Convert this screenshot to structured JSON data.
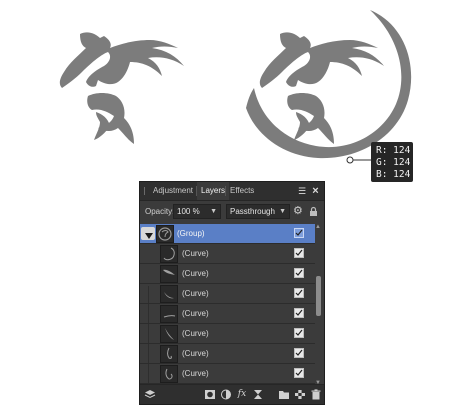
{
  "colors": {
    "artwork_gray": "#7c7c7c",
    "panel_bg": "#3b3b3b",
    "selection_blue": "#5a7fc6"
  },
  "color_readout": {
    "r": "R: 124",
    "g": "G: 124",
    "b": "B: 124"
  },
  "panel": {
    "tabs": [
      "Adjustment",
      "Layers",
      "Effects"
    ],
    "active_tab": "Layers",
    "opacity_label": "Opacity:",
    "opacity_value": "100 %",
    "blend_mode": "Passthrough",
    "layers": [
      {
        "name": "(Group)",
        "selected": true,
        "visible": true
      },
      {
        "name": "(Curve)",
        "selected": false,
        "visible": true
      },
      {
        "name": "(Curve)",
        "selected": false,
        "visible": true
      },
      {
        "name": "(Curve)",
        "selected": false,
        "visible": true
      },
      {
        "name": "(Curve)",
        "selected": false,
        "visible": true
      },
      {
        "name": "(Curve)",
        "selected": false,
        "visible": true
      },
      {
        "name": "(Curve)",
        "selected": false,
        "visible": true
      },
      {
        "name": "(Curve)",
        "selected": false,
        "visible": true
      }
    ],
    "icons": {
      "menu": "panel-menu-icon",
      "close": "close-icon",
      "gear": "gear-icon",
      "lock": "lock-icon",
      "bottom": [
        "layers-stack-icon",
        "mask-icon",
        "adjustment-icon",
        "fx-icon",
        "live-filter-icon",
        "folder-icon",
        "pixel-layer-icon",
        "trash-icon"
      ]
    }
  }
}
